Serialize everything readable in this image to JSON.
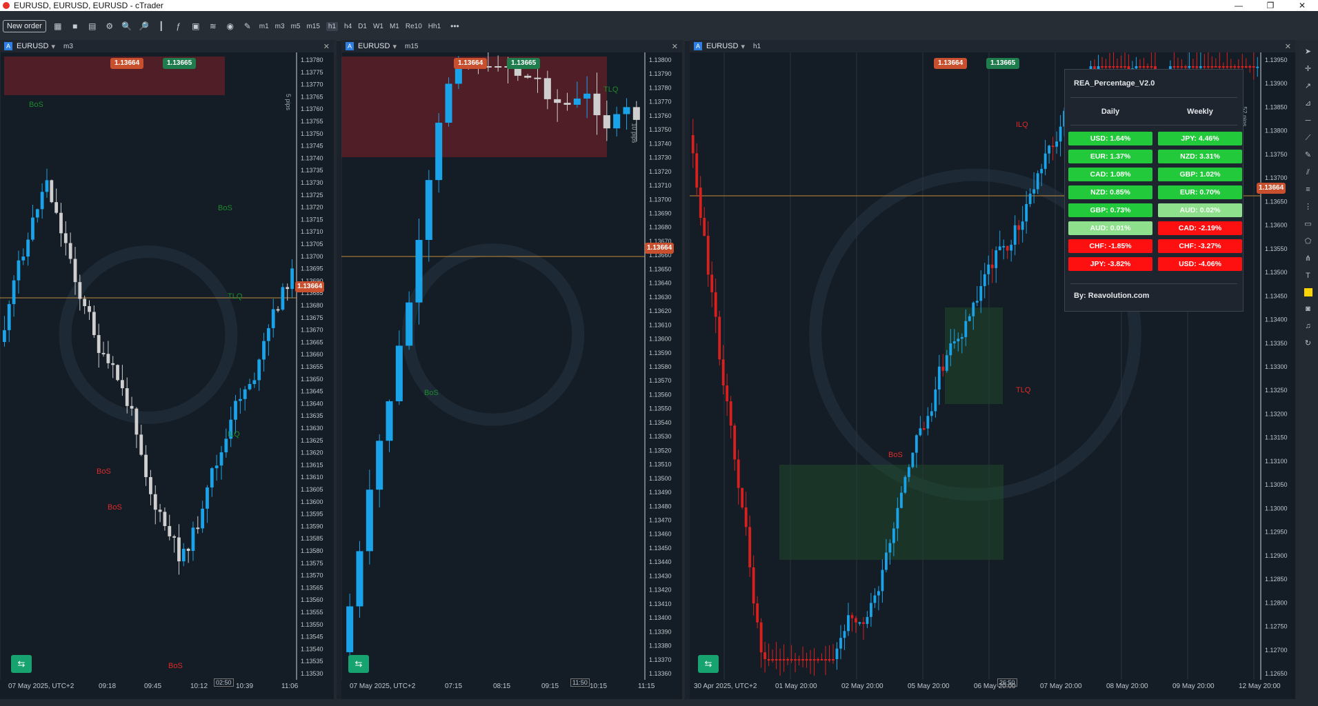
{
  "window": {
    "title": "EURUSD, EURUSD, EURUSD - cTrader",
    "controls": [
      "—",
      "❐",
      "✕"
    ]
  },
  "toolbar": {
    "new_order": "New order",
    "timeframes": [
      "m1",
      "m3",
      "m5",
      "m15",
      "h1",
      "h4",
      "D1",
      "W1",
      "M1",
      "Re10",
      "Hh1"
    ],
    "active_timeframe": "h1",
    "more": "•••"
  },
  "panels": [
    {
      "symbol": "EURUSD",
      "timeframe": "m3",
      "sell_price": "1.13664",
      "buy_price": "1.13665",
      "current_price": "1.13664",
      "range_label": "5 pips",
      "timer": "02:50",
      "date_label": "07 May 2025, UTC+2",
      "times": [
        "09:18",
        "09:45",
        "10:12",
        "10:39",
        "11:06"
      ],
      "prices": [
        "1.13780",
        "1.13775",
        "1.13770",
        "1.13765",
        "1.13760",
        "1.13755",
        "1.13750",
        "1.13745",
        "1.13740",
        "1.13735",
        "1.13730",
        "1.13725",
        "1.13720",
        "1.13715",
        "1.13710",
        "1.13705",
        "1.13700",
        "1.13695",
        "1.13690",
        "1.13685",
        "1.13680",
        "1.13675",
        "1.13670",
        "1.13665",
        "1.13660",
        "1.13655",
        "1.13650",
        "1.13645",
        "1.13640",
        "1.13635",
        "1.13630",
        "1.13625",
        "1.13620",
        "1.13615",
        "1.13610",
        "1.13605",
        "1.13600",
        "1.13595",
        "1.13590",
        "1.13585",
        "1.13580",
        "1.13575",
        "1.13570",
        "1.13565",
        "1.13560",
        "1.13555",
        "1.13550",
        "1.13545",
        "1.13540",
        "1.13535",
        "1.13530"
      ],
      "labels": {
        "bos1": "BoS",
        "bos2": "BoS",
        "bos3": "BoS",
        "bos4": "BoS",
        "bos5": "BoS",
        "tlq": "TLQ",
        "ilq": "ILQ"
      }
    },
    {
      "symbol": "EURUSD",
      "timeframe": "m15",
      "sell_price": "1.13664",
      "buy_price": "1.13665",
      "current_price": "1.13664",
      "range_label": "10 pips",
      "timer": "11:50",
      "date_label": "07 May 2025, UTC+2",
      "times": [
        "07:15",
        "08:15",
        "09:15",
        "10:15",
        "11:15"
      ],
      "prices": [
        "1.13800",
        "1.13790",
        "1.13780",
        "1.13770",
        "1.13760",
        "1.13750",
        "1.13740",
        "1.13730",
        "1.13720",
        "1.13710",
        "1.13700",
        "1.13690",
        "1.13680",
        "1.13670",
        "1.13660",
        "1.13650",
        "1.13640",
        "1.13630",
        "1.13620",
        "1.13610",
        "1.13600",
        "1.13590",
        "1.13580",
        "1.13570",
        "1.13560",
        "1.13550",
        "1.13540",
        "1.13530",
        "1.13520",
        "1.13510",
        "1.13500",
        "1.13490",
        "1.13480",
        "1.13470",
        "1.13460",
        "1.13450",
        "1.13440",
        "1.13430",
        "1.13420",
        "1.13410",
        "1.13400",
        "1.13390",
        "1.13380",
        "1.13370",
        "1.13360"
      ],
      "labels": {
        "tlq": "TLQ",
        "bos": "BoS"
      }
    },
    {
      "symbol": "EURUSD",
      "timeframe": "h1",
      "sell_price": "1.13664",
      "buy_price": "1.13665",
      "current_price": "1.13664",
      "range_label": "52 pips",
      "timer": "26:50",
      "date_label": "30 Apr 2025, UTC+2",
      "times": [
        "01 May 20:00",
        "02 May 20:00",
        "05 May 20:00",
        "06 May 20:00",
        "07 May 20:00",
        "08 May 20:00",
        "09 May 20:00",
        "12 May 20:00"
      ],
      "prices": [
        "1.13950",
        "1.13900",
        "1.13850",
        "1.13800",
        "1.13750",
        "1.13700",
        "1.13650",
        "1.13600",
        "1.13550",
        "1.13500",
        "1.13450",
        "1.13400",
        "1.13350",
        "1.13300",
        "1.13250",
        "1.13200",
        "1.13150",
        "1.13100",
        "1.13050",
        "1.13000",
        "1.12950",
        "1.12900",
        "1.12850",
        "1.12800",
        "1.12750",
        "1.12700",
        "1.12650"
      ],
      "labels": {
        "ilq": "ILQ",
        "tlq": "TLQ",
        "bos": "BoS"
      }
    }
  ],
  "indicator": {
    "title": "REA_Percentage_V2.0",
    "daily_header": "Daily",
    "weekly_header": "Weekly",
    "daily": [
      {
        "t": "USD: 1.64%",
        "c": "#22c93a"
      },
      {
        "t": "EUR: 1.37%",
        "c": "#22c93a"
      },
      {
        "t": "CAD: 1.08%",
        "c": "#22c93a"
      },
      {
        "t": "NZD: 0.85%",
        "c": "#22c93a"
      },
      {
        "t": "GBP: 0.73%",
        "c": "#22c93a"
      },
      {
        "t": "AUD: 0.01%",
        "c": "#8fe08d"
      },
      {
        "t": "CHF: -1.85%",
        "c": "#ff1010"
      },
      {
        "t": "JPY: -3.82%",
        "c": "#ff1010"
      }
    ],
    "weekly": [
      {
        "t": "JPY: 4.46%",
        "c": "#22c93a"
      },
      {
        "t": "NZD: 3.31%",
        "c": "#22c93a"
      },
      {
        "t": "GBP: 1.02%",
        "c": "#22c93a"
      },
      {
        "t": "EUR: 0.70%",
        "c": "#22c93a"
      },
      {
        "t": "AUD: 0.02%",
        "c": "#8fe08d"
      },
      {
        "t": "CAD: -2.19%",
        "c": "#ff1010"
      },
      {
        "t": "CHF: -3.27%",
        "c": "#ff1010"
      },
      {
        "t": "USD: -4.06%",
        "c": "#ff1010"
      }
    ],
    "byline": "By: Reavolution.com"
  }
}
